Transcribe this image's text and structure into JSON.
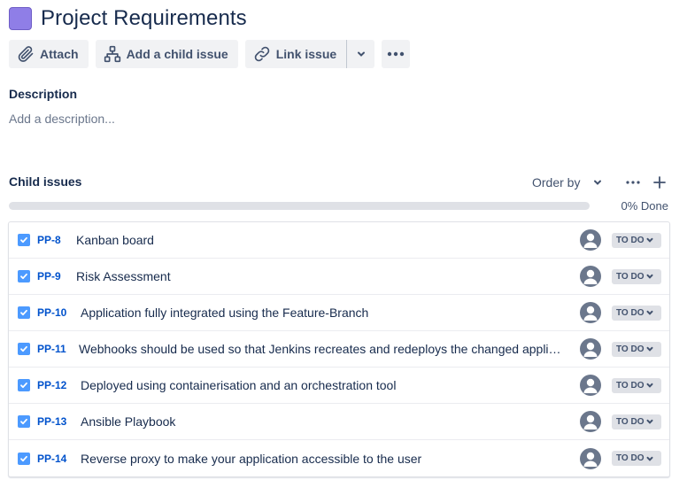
{
  "issue": {
    "title": "Project Requirements",
    "type_icon": "epic-square-icon",
    "type_color": "#8f7ee7"
  },
  "toolbar": {
    "attach_label": "Attach",
    "add_child_label": "Add a child issue",
    "link_issue_label": "Link issue"
  },
  "description": {
    "label": "Description",
    "placeholder": "Add a description..."
  },
  "child_issues": {
    "label": "Child issues",
    "order_by_label": "Order by",
    "progress_fraction": 0,
    "progress_text": "0% Done",
    "items": [
      {
        "key": "PP-8",
        "summary": "Kanban board",
        "status": "TO DO"
      },
      {
        "key": "PP-9",
        "summary": "Risk Assessment",
        "status": "TO DO"
      },
      {
        "key": "PP-10",
        "summary": "Application fully integrated using the Feature-Branch",
        "status": "TO DO"
      },
      {
        "key": "PP-11",
        "summary": "Webhooks should be used so that Jenkins recreates and redeploys the changed application",
        "status": "TO DO"
      },
      {
        "key": "PP-12",
        "summary": "Deployed using containerisation and an orchestration tool",
        "status": "TO DO"
      },
      {
        "key": "PP-13",
        "summary": "Ansible Playbook",
        "status": "TO DO"
      },
      {
        "key": "PP-14",
        "summary": "Reverse proxy to make your application accessible to the user",
        "status": "TO DO"
      }
    ]
  },
  "colors": {
    "link": "#0052cc",
    "checkbox": "#4c9aff",
    "status_bg": "#dfe1e6",
    "progress_track": "#dfe1e6"
  }
}
